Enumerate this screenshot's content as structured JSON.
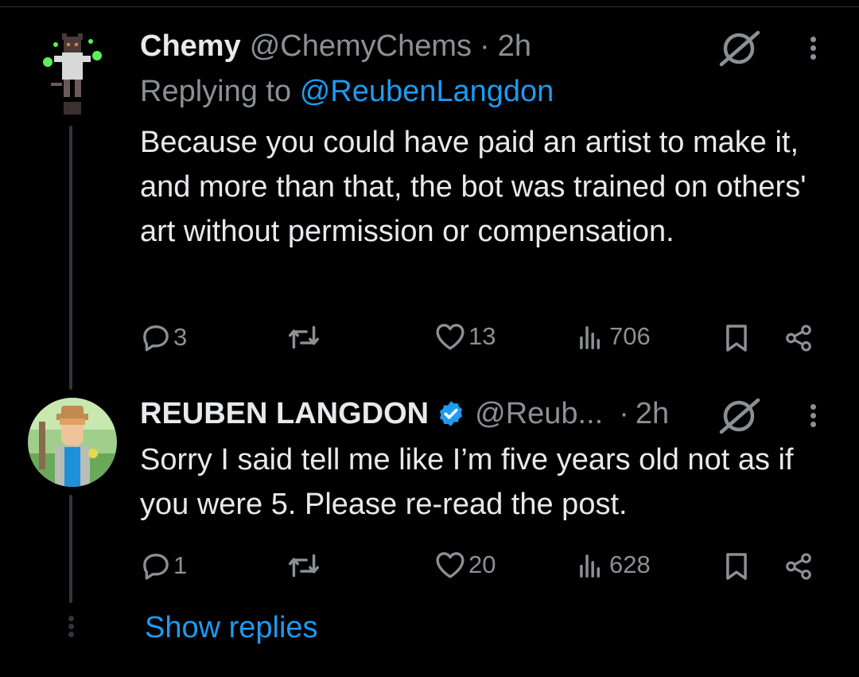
{
  "tweets": [
    {
      "display_name": "Chemy",
      "handle": "@ChemyChems",
      "separator": "·",
      "time": "2h",
      "replying_prefix": "Replying to",
      "replying_to": "@ReubenLangdon",
      "text": "Because you could have paid an artist to make it, and more than that, the bot was trained on others' art without permission or compensation.",
      "replies": "3",
      "reposts": "",
      "likes": "13",
      "views": "706"
    },
    {
      "display_name": "REUBEN LANGDON",
      "verified": true,
      "handle": "@Reub...",
      "separator": "·",
      "time": "2h",
      "text": "Sorry I said tell me like I’m five years old not as if you were 5. Please re-read the post.",
      "replies": "1",
      "reposts": "",
      "likes": "20",
      "views": "628"
    }
  ],
  "show_replies_label": "Show replies",
  "colors": {
    "background": "#000000",
    "text": "#e7e9ea",
    "muted": "#8b9095",
    "accent": "#1d9bf0",
    "thread": "#333639"
  }
}
